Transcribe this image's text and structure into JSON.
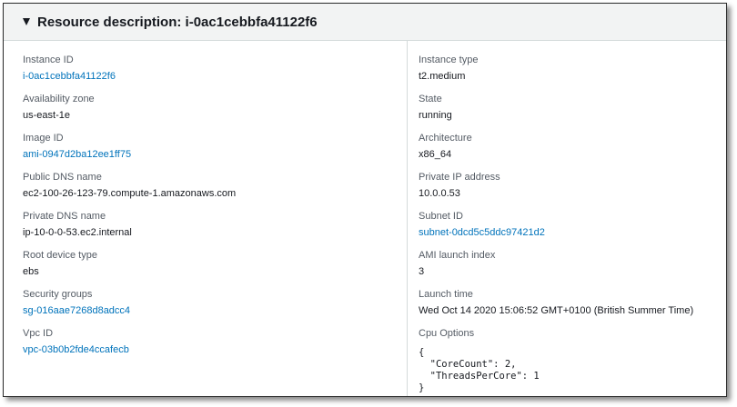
{
  "header": {
    "title": "Resource description: i-0ac1cebbfa41122f6"
  },
  "left": [
    {
      "label": "Instance ID",
      "value": "i-0ac1cebbfa41122f6",
      "link": true
    },
    {
      "label": "Availability zone",
      "value": "us-east-1e",
      "link": false
    },
    {
      "label": "Image ID",
      "value": "ami-0947d2ba12ee1ff75",
      "link": true
    },
    {
      "label": "Public DNS name",
      "value": "ec2-100-26-123-79.compute-1.amazonaws.com",
      "link": false
    },
    {
      "label": "Private DNS name",
      "value": "ip-10-0-0-53.ec2.internal",
      "link": false
    },
    {
      "label": "Root device type",
      "value": "ebs",
      "link": false
    },
    {
      "label": "Security groups",
      "value": "sg-016aae7268d8adcc4",
      "link": true
    },
    {
      "label": "Vpc ID",
      "value": "vpc-03b0b2fde4ccafecb",
      "link": true
    }
  ],
  "right": [
    {
      "label": "Instance type",
      "value": "t2.medium",
      "link": false
    },
    {
      "label": "State",
      "value": "running",
      "link": false
    },
    {
      "label": "Architecture",
      "value": "x86_64",
      "link": false
    },
    {
      "label": "Private IP address",
      "value": "10.0.0.53",
      "link": false
    },
    {
      "label": "Subnet ID",
      "value": "subnet-0dcd5c5ddc97421d2",
      "link": true
    },
    {
      "label": "AMI launch index",
      "value": "3",
      "link": false
    },
    {
      "label": "Launch time",
      "value": "Wed Oct 14 2020 15:06:52 GMT+0100 (British Summer Time)",
      "link": false
    },
    {
      "label": "Cpu Options",
      "value": "{\n  \"CoreCount\": 2,\n  \"ThreadsPerCore\": 1\n}",
      "link": false
    }
  ]
}
